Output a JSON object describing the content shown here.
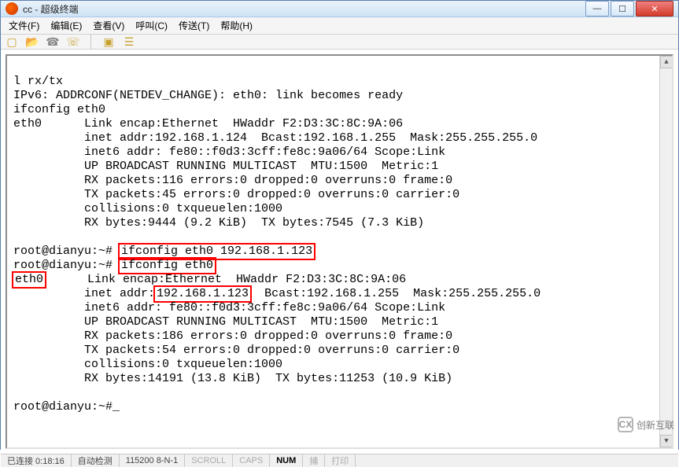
{
  "window": {
    "title": "cc - 超级终端"
  },
  "menu": {
    "file": "文件(F)",
    "edit": "编辑(E)",
    "view": "查看(V)",
    "call": "呼叫(C)",
    "transfer": "传送(T)",
    "help": "帮助(H)"
  },
  "terminal": {
    "l1": "l rx/tx",
    "l2": "IPv6: ADDRCONF(NETDEV_CHANGE): eth0: link becomes ready",
    "l3": "ifconfig eth0",
    "l4": "eth0      Link encap:Ethernet  HWaddr F2:D3:3C:8C:9A:06",
    "l5": "          inet addr:192.168.1.124  Bcast:192.168.1.255  Mask:255.255.255.0",
    "l6": "          inet6 addr: fe80::f0d3:3cff:fe8c:9a06/64 Scope:Link",
    "l7": "          UP BROADCAST RUNNING MULTICAST  MTU:1500  Metric:1",
    "l8": "          RX packets:116 errors:0 dropped:0 overruns:0 frame:0",
    "l9": "          TX packets:45 errors:0 dropped:0 overruns:0 carrier:0",
    "l10": "          collisions:0 txqueuelen:1000",
    "l11": "          RX bytes:9444 (9.2 KiB)  TX bytes:7545 (7.3 KiB)",
    "blank1": "",
    "p1a": "root@dianyu:~# ",
    "p1b": "ifconfig eth0 192.168.1.123",
    "p2a": "root@dianyu:~# ",
    "p2b": "ifconfig eth0",
    "e1": "eth0",
    "e2": "      Link encap:Ethernet  HWaddr F2:D3:3C:8C:9A:06",
    "i1": "          inet addr:",
    "i2": "192.168.1.123",
    "i3": "  Bcast:192.168.1.255  Mask:255.255.255.0",
    "r1": "          inet6 addr: fe80::f0d3:3cff:fe8c:9a06/64 Scope:Link",
    "r2": "          UP BROADCAST RUNNING MULTICAST  MTU:1500  Metric:1",
    "r3": "          RX packets:186 errors:0 dropped:0 overruns:0 frame:0",
    "r4": "          TX packets:54 errors:0 dropped:0 overruns:0 carrier:0",
    "r5": "          collisions:0 txqueuelen:1000",
    "r6": "          RX bytes:14191 (13.8 KiB)  TX bytes:11253 (10.9 KiB)",
    "blank2": "",
    "pend": "root@dianyu:~#_"
  },
  "status": {
    "conn": "已连接 0:18:16",
    "detect": "自动检测",
    "baud": "115200 8-N-1",
    "scroll": "SCROLL",
    "caps": "CAPS",
    "num": "NUM",
    "capture": "捕",
    "print": "打印"
  },
  "watermark": {
    "icon": "CX",
    "text": "创新互联"
  }
}
